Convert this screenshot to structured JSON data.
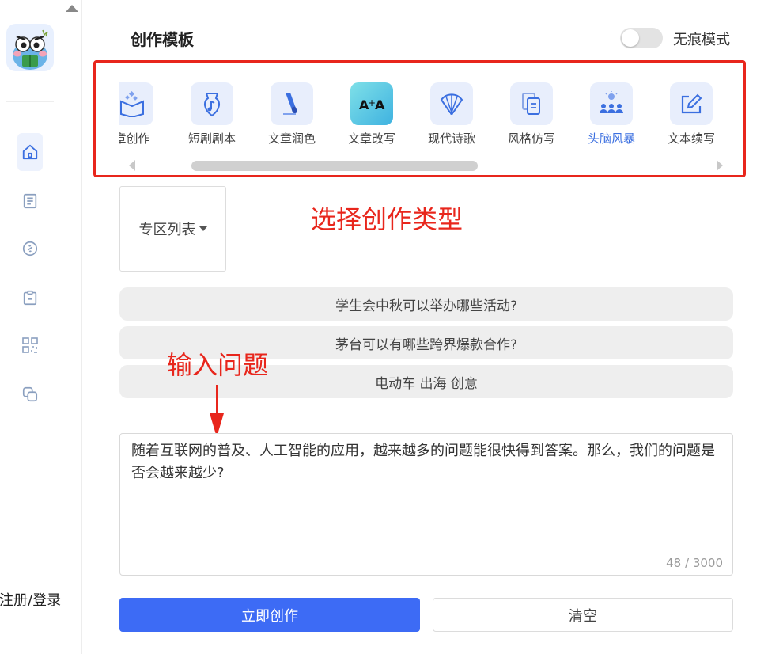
{
  "header": {
    "title": "创作模板",
    "incognito_label": "无痕模式"
  },
  "sidebar": {
    "login_label": "注册/登录",
    "nav": [
      {
        "icon": "home-icon",
        "active": true
      },
      {
        "icon": "document-icon",
        "active": false
      },
      {
        "icon": "link-icon",
        "active": false
      },
      {
        "icon": "clipboard-icon",
        "active": false
      },
      {
        "icon": "grid-icon",
        "active": false
      },
      {
        "icon": "copy-icon",
        "active": false
      }
    ]
  },
  "templates": [
    {
      "label": "章创作",
      "icon": "book-create-icon"
    },
    {
      "label": "短剧剧本",
      "icon": "pen-nib-icon"
    },
    {
      "label": "文章润色",
      "icon": "brush-icon"
    },
    {
      "label": "文章改写",
      "icon": "text-rewrite-icon"
    },
    {
      "label": "现代诗歌",
      "icon": "fan-icon"
    },
    {
      "label": "风格仿写",
      "icon": "documents-icon"
    },
    {
      "label": "头脑风暴",
      "icon": "team-idea-icon",
      "active": true
    },
    {
      "label": "文本续写",
      "icon": "edit-box-icon"
    }
  ],
  "zone": {
    "label": "专区列表"
  },
  "annotations": {
    "select_type": "选择创作类型",
    "input_question": "输入问题"
  },
  "suggestions": [
    "学生会中秋可以举办哪些活动?",
    "茅台可以有哪些跨界爆款合作?",
    "电动车 出海 创意"
  ],
  "input": {
    "value": "随着互联网的普及、人工智能的应用，越来越多的问题能很快得到答案。那么，我们的问题是否会越来越少?",
    "counter": "48 / 3000"
  },
  "actions": {
    "create_label": "立即创作",
    "clear_label": "清空"
  },
  "colors": {
    "primary": "#3d6bf5",
    "annotation": "#e8261c",
    "active_tab": "#3b6fe0"
  }
}
